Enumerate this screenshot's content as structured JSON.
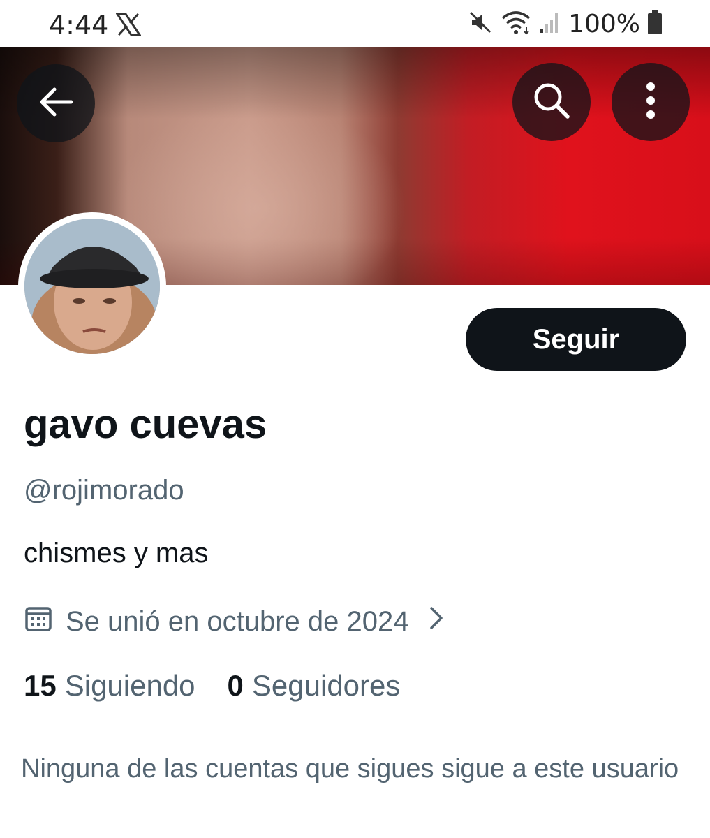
{
  "status_bar": {
    "time": "4:44",
    "battery": "100%",
    "icons": [
      "x-logo-icon",
      "mute-icon",
      "wifi-icon",
      "signal-icon",
      "battery-icon"
    ]
  },
  "header": {
    "back_icon": "arrow-left-icon",
    "search_icon": "search-icon",
    "more_icon": "more-vertical-icon"
  },
  "profile": {
    "follow_label": "Seguir",
    "name": "gavo cuevas",
    "handle": "@rojimorado",
    "bio": "chismes y mas",
    "joined": "Se unió en octubre de 2024",
    "following_count": "15",
    "following_label": "Siguiendo",
    "followers_count": "0",
    "followers_label": "Seguidores",
    "mutuals_note": "Ninguna de las cuentas que sigues sigue a este usuario"
  },
  "colors": {
    "primary_text": "#0f1419",
    "secondary_text": "#536471",
    "button_bg": "#0f1419",
    "banner_red": "#e0121c"
  }
}
